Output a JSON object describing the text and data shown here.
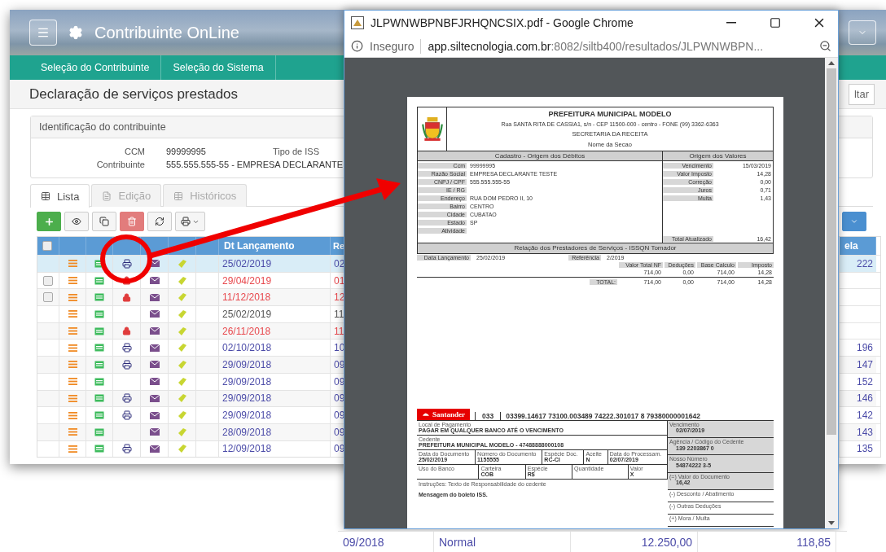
{
  "app": {
    "title": "Contribuinte OnLine",
    "nav": [
      "Seleção do Contribuinte",
      "Seleção do Sistema"
    ],
    "page_title": "Declaração de serviços prestados",
    "title_button": "ltar",
    "identification": {
      "heading": "Identificação do contribuinte",
      "ccm_label": "CCM",
      "ccm": "99999995",
      "iss_label": "Tipo de ISS",
      "contributor_label": "Contribuinte",
      "contributor": "555.555.555-55 - EMPRESA DECLARANTE"
    },
    "tabs": [
      {
        "label": "Lista",
        "selected": true
      },
      {
        "label": "Edição",
        "selected": false
      },
      {
        "label": "Históricos",
        "selected": false
      }
    ],
    "table": {
      "select_all_checked": false,
      "columns": [
        "Dt Lançamento",
        "Re",
        "ela"
      ],
      "rows": [
        {
          "selected": true,
          "selectable": false,
          "kind": "print",
          "date": "25/02/2019",
          "color": "#4b4ba8",
          "ref": "02",
          "last": "222"
        },
        {
          "selected": false,
          "selectable": true,
          "kind": "lock",
          "date": "29/04/2019",
          "color": "#e8474c",
          "ref": "01"
        },
        {
          "selected": false,
          "selectable": true,
          "kind": "lock",
          "date": "11/12/2018",
          "color": "#e8474c",
          "ref": "12"
        },
        {
          "selected": false,
          "selectable": false,
          "kind": "none",
          "date": "25/02/2019",
          "color": "#555555",
          "ref": "11"
        },
        {
          "selected": false,
          "selectable": false,
          "kind": "lock",
          "date": "26/11/2018",
          "color": "#e8474c",
          "ref": "11"
        },
        {
          "selected": false,
          "selectable": false,
          "kind": "print",
          "date": "02/10/2018",
          "color": "#4b4ba8",
          "ref": "10",
          "last": "196"
        },
        {
          "selected": false,
          "selectable": false,
          "kind": "print",
          "date": "29/09/2018",
          "color": "#4b4ba8",
          "ref": "09",
          "last": "147"
        },
        {
          "selected": false,
          "selectable": false,
          "kind": "none",
          "date": "29/09/2018",
          "color": "#4b4ba8",
          "ref": "09",
          "last": "152"
        },
        {
          "selected": false,
          "selectable": false,
          "kind": "print",
          "date": "29/09/2018",
          "color": "#4b4ba8",
          "ref": "09",
          "last": "146"
        },
        {
          "selected": false,
          "selectable": false,
          "kind": "print",
          "date": "29/09/2018",
          "color": "#4b4ba8",
          "ref": "09",
          "last": "142"
        },
        {
          "selected": false,
          "selectable": false,
          "kind": "none",
          "date": "28/09/2018",
          "color": "#4b4ba8",
          "ref": "09",
          "last": "143"
        },
        {
          "selected": false,
          "selectable": false,
          "kind": "print",
          "date": "12/09/2018",
          "color": "#4b4ba8",
          "ref": "09",
          "last": "135"
        }
      ]
    }
  },
  "browser": {
    "title": "JLPWNWBPNBFJRHQNCSIX.pdf - Google Chrome",
    "security": "Inseguro",
    "url_host": "app.siltecnologia.com.br",
    "url_rest": ":8082/siltb400/resultados/JLPWNWBPN...",
    "pdf": {
      "title": "PREFEITURA MUNICIPAL MODELO",
      "address": "Rua SANTA RITA DE CASSIA1, s/n - CEP 11500-000 - centro - FONE (99) 3362-6363",
      "department": "SECRETARIA DA RECEITA",
      "section": "Nome da Secao",
      "cadastro_title": "Cadastro - Origem dos Débitos",
      "cadastro": [
        {
          "label": "Ccm",
          "value": "99999995"
        },
        {
          "label": "Razão Social",
          "value": "EMPRESA DECLARANTE TESTE"
        },
        {
          "label": "CNPJ / CPF",
          "value": "555.555.555-55"
        },
        {
          "label": "IE / RG"
        },
        {
          "label": "Endereço",
          "value": "RUA DOM PEDRO II, 10"
        },
        {
          "label": "Bairro",
          "value": "CENTRO"
        },
        {
          "label": "Cidade",
          "value": "CUBATAO"
        },
        {
          "label": "Estado",
          "value": "SP"
        },
        {
          "label": "Atividade"
        }
      ],
      "valores_title": "Origem dos Valores",
      "valores": [
        {
          "label": "Vencimento",
          "value": "15/03/2019"
        },
        {
          "label": "Valor Imposto",
          "value": "14,28"
        },
        {
          "label": "Correção",
          "value": "0,00"
        },
        {
          "label": "Juros",
          "value": "0,71"
        },
        {
          "label": "Multa",
          "value": "1,43"
        }
      ],
      "total_label": "Total Atualizado",
      "total": "16,42",
      "relacao_title": "Relação dos Prestadores de Serviços - ISSQN Tomador",
      "launch_label": "Data Lançamento",
      "launch": "25/02/2019",
      "ref_label": "Referência",
      "ref": "2/2019",
      "columns": [
        "Valor Total NF",
        "Deduções",
        "Base Calculo",
        "Imposto"
      ],
      "row": [
        "714,00",
        "0,00",
        "714,00",
        "14,28"
      ],
      "total_row_label": "TOTAL:",
      "total_row": [
        "714,00",
        "0,00",
        "714,00",
        "14,28"
      ],
      "boleto": {
        "bank": "Santander",
        "code": "033",
        "line": "03399.14617 73100.003489 74222.301017 8 79380000001642",
        "left": [
          [
            {
              "label": "Local de Pagamento",
              "value": "PAGAR EM QUALQUER BANCO ATÉ O VENCIMENTO"
            }
          ],
          [
            {
              "label": "Cedente",
              "value": "PREFEITURA MUNICIPAL MODELO - 47488888000108"
            }
          ],
          [
            {
              "label": "Data do Documento",
              "value": "25/02/2019"
            },
            {
              "label": "Número do Documento",
              "value": "1155555"
            },
            {
              "label": "Espécie Doc.",
              "value": "RC-CI"
            },
            {
              "label": "Aceite",
              "value": "N"
            },
            {
              "label": "Data do Processam.",
              "value": "02/07/2019"
            }
          ],
          [
            {
              "label": "Uso do Banco"
            },
            {
              "label": "Carteira",
              "value": "COB"
            },
            {
              "label": "Espécie",
              "value": "R$"
            },
            {
              "label": "Quantidade"
            },
            {
              "label": "Valor",
              "value": "X"
            }
          ]
        ],
        "instructions": "Instruções: Texto de Responsabilidade do cedente",
        "message": "Mensagem do boleto ISS.",
        "right": [
          {
            "label": "Vencimento",
            "value": "02/07/2019"
          },
          {
            "label": "Agência / Código do Cedente",
            "value": "139 2203867 0"
          },
          {
            "label": "Nosso Número",
            "value": "54874222 3-5"
          },
          {
            "label": "(=) Valor do Documento",
            "value": "16,42"
          },
          {
            "label": "(-) Desconto / Abatimento"
          },
          {
            "label": "(-) Outras Deduções"
          },
          {
            "label": "(+) Mora / Multa"
          }
        ]
      }
    }
  },
  "lower_row": [
    "09/2018",
    "Normal",
    "12.250,00",
    "118,85"
  ]
}
